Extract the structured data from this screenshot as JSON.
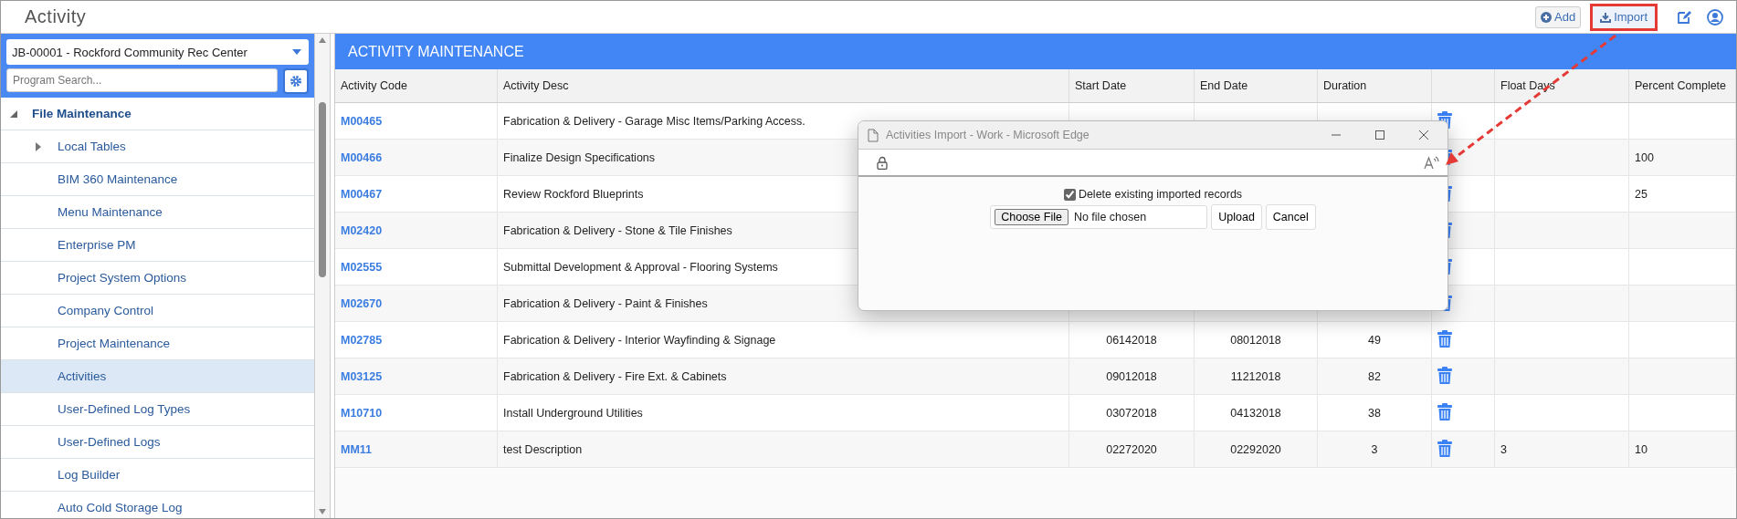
{
  "app_title": "Activity",
  "toolbar": [
    {
      "kind": "add",
      "label": "Add",
      "highlighted": false
    },
    {
      "kind": "import",
      "label": "Import",
      "highlighted": true
    }
  ],
  "sidebar": {
    "project": "JB-00001 - Rockford Community Rec Center",
    "search": {
      "placeholder": "Program Search..."
    },
    "items": [
      {
        "label": "File Maintenance",
        "expanded": true,
        "selected": false,
        "children": [
          {
            "label": "Local Tables",
            "expanded": false,
            "selected": false
          },
          {
            "label": "BIM 360 Maintenance",
            "selected": false
          },
          {
            "label": "Menu Maintenance",
            "selected": false
          },
          {
            "label": "Enterprise PM",
            "selected": false
          },
          {
            "label": "Project System Options",
            "selected": false
          },
          {
            "label": "Company Control",
            "selected": false
          },
          {
            "label": "Project Maintenance",
            "selected": false
          },
          {
            "label": "Activities",
            "selected": true
          },
          {
            "label": "User-Defined Log Types",
            "selected": false
          },
          {
            "label": "User-Defined Logs",
            "selected": false
          },
          {
            "label": "Log Builder",
            "selected": false
          },
          {
            "label": "Auto Cold Storage Log",
            "selected": false
          }
        ]
      }
    ]
  },
  "panel_title": "ACTIVITY MAINTENANCE",
  "table": {
    "columns": [
      "Activity Code",
      "Activity Desc",
      "Start Date",
      "End Date",
      "Duration",
      "",
      "Float Days",
      "Percent Complete"
    ],
    "rows": [
      {
        "code": "M00465",
        "desc": "Fabrication & Delivery - Garage Misc Items/Parking Access.",
        "start": "",
        "end": "",
        "duration": "",
        "float": "",
        "percent": ""
      },
      {
        "code": "M00466",
        "desc": "Finalize Design Specifications",
        "start": "",
        "end": "",
        "duration": "",
        "float": "",
        "percent": "100"
      },
      {
        "code": "M00467",
        "desc": "Review Rockford Blueprints",
        "start": "",
        "end": "",
        "duration": "",
        "float": "",
        "percent": "25"
      },
      {
        "code": "M02420",
        "desc": "Fabrication & Delivery - Stone & Tile Finishes",
        "start": "",
        "end": "",
        "duration": "",
        "float": "",
        "percent": ""
      },
      {
        "code": "M02555",
        "desc": "Submittal Development & Approval - Flooring Systems",
        "start": "",
        "end": "",
        "duration": "",
        "float": "",
        "percent": ""
      },
      {
        "code": "M02670",
        "desc": "Fabrication & Delivery - Paint & Finishes",
        "start": "",
        "end": "",
        "duration": "",
        "float": "",
        "percent": ""
      },
      {
        "code": "M02785",
        "desc": "Fabrication & Delivery - Interior Wayfinding & Signage",
        "start": "06142018",
        "end": "08012018",
        "duration": "49",
        "float": "",
        "percent": ""
      },
      {
        "code": "M03125",
        "desc": "Fabrication & Delivery - Fire Ext. & Cabinets",
        "start": "09012018",
        "end": "11212018",
        "duration": "82",
        "float": "",
        "percent": ""
      },
      {
        "code": "M10710",
        "desc": "Install Underground Utilities",
        "start": "03072018",
        "end": "04132018",
        "duration": "38",
        "float": "",
        "percent": ""
      },
      {
        "code": "MM11",
        "desc": "test Description",
        "start": "02272020",
        "end": "02292020",
        "duration": "3",
        "float": "3",
        "percent": "10"
      }
    ]
  },
  "popup": {
    "title": "Activities Import - Work - Microsoft Edge",
    "checkbox": {
      "label": "Delete existing imported records",
      "checked": true
    },
    "file_button": "Choose File",
    "file_status": "No file chosen",
    "buttons": [
      "Upload",
      "Cancel"
    ]
  }
}
